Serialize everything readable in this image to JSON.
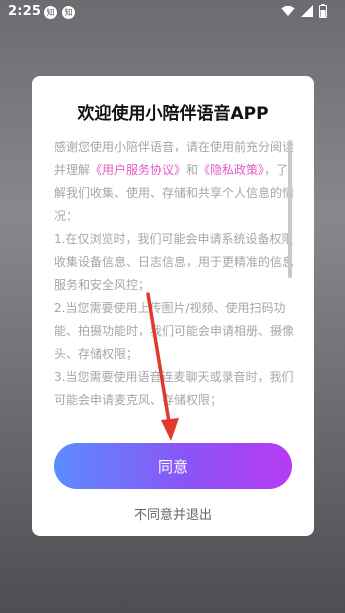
{
  "statusbar": {
    "time": "2:25",
    "notif_icons": [
      "知",
      "知"
    ]
  },
  "dialog": {
    "title": "欢迎使用小陪伴语音APP",
    "intro_prefix": "感谢您使用小陪伴语音，请在使用前充分阅读并理解",
    "link_user_agreement": "《用户服务协议》",
    "and": "和",
    "link_privacy_policy": "《隐私政策》",
    "intro_suffix": "，了解我们收集、使用、存储和共享个人信息的情况：",
    "item1": "1.在仅浏览时，我们可能会申请系统设备权限收集设备信息、日志信息，用于更精准的信息服务和安全风控；",
    "item2": "2.当您需要使用上传图片/视频、使用扫码功能、拍摄功能时，我们可能会申请相册、摄像头、存储权限；",
    "item3": "3.当您需要使用语音连麦聊天或录音时，我们可能会申请麦克风、存储权限；",
    "agree_label": "同意",
    "disagree_label": "不同意并退出"
  },
  "colors": {
    "link": "#e35cc4",
    "agree_gradient_start": "#5b8cff",
    "agree_gradient_end": "#b63af3",
    "annotation_arrow": "#e03a2e"
  }
}
